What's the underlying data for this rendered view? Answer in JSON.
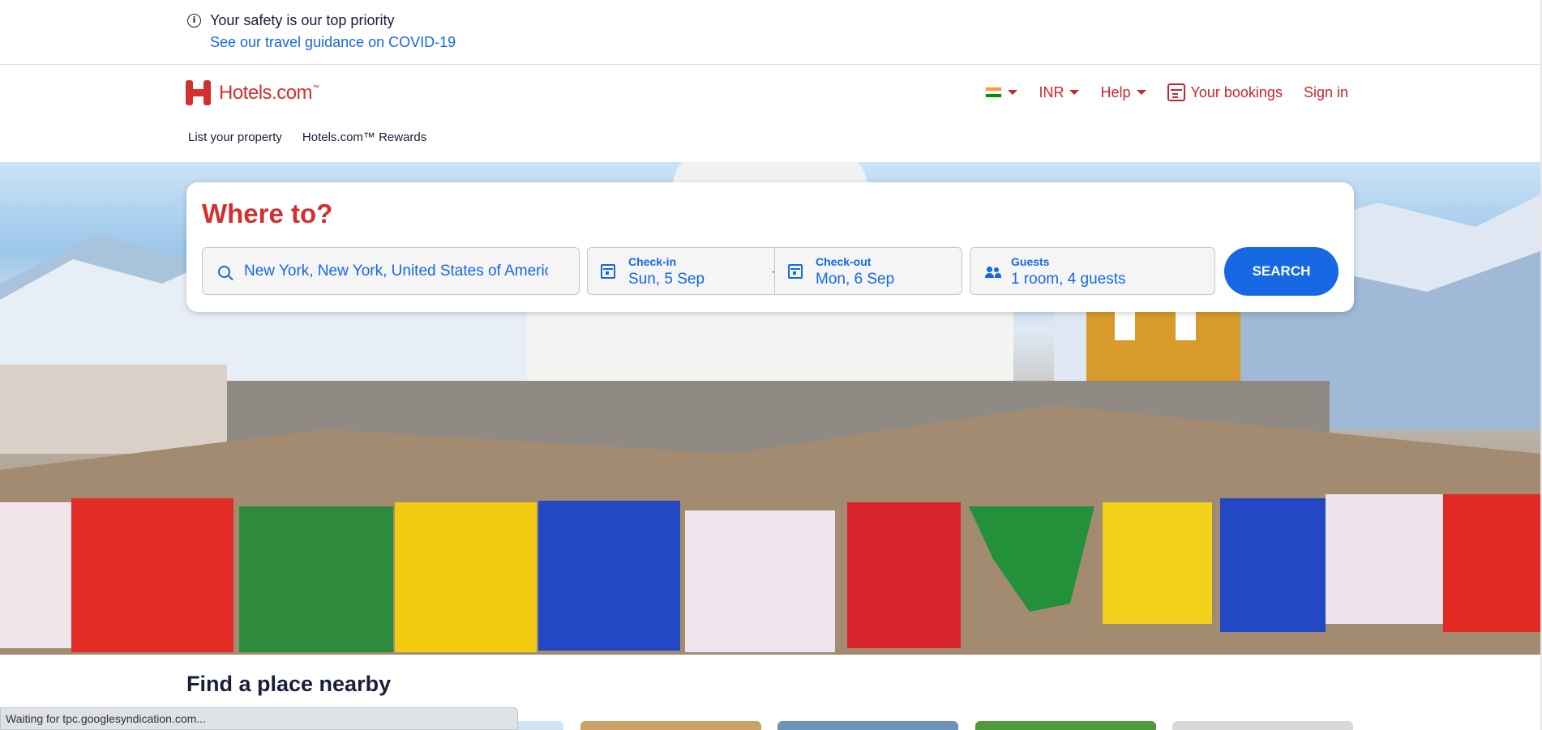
{
  "safety_banner": {
    "title": "Your safety is our top priority",
    "link": "See our travel guidance on COVID-19"
  },
  "header": {
    "logo_text": "Hotels.com",
    "logo_tm": "™",
    "currency": "INR",
    "help": "Help",
    "your_bookings": "Your bookings",
    "sign_in": "Sign in",
    "flag": "India",
    "subnav": {
      "list_property": "List your property",
      "rewards": "Hotels.com™ Rewards"
    }
  },
  "search": {
    "title": "Where to?",
    "destination": "New York, New York, United States of America",
    "checkin_label": "Check-in",
    "checkin_value": "Sun, 5 Sep",
    "checkout_label": "Check-out",
    "checkout_value": "Mon, 6 Sep",
    "guests_label": "Guests",
    "guests_value": "1 room, 4 guests",
    "button": "SEARCH"
  },
  "nearby": {
    "title": "Find a place nearby"
  },
  "status_bar": {
    "text": "Waiting for tpc.googlesyndication.com..."
  },
  "colors": {
    "brand_red": "#d32f2f",
    "link_blue": "#1668e3",
    "primary_button": "#1668e3"
  }
}
